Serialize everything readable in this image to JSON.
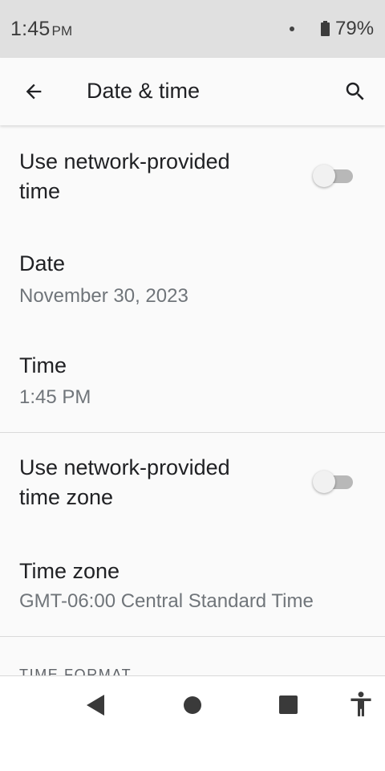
{
  "status_bar": {
    "time": "1:45",
    "ampm": "PM",
    "battery": "79%"
  },
  "app_bar": {
    "title": "Date & time",
    "back_icon": "arrow-back-icon",
    "search_icon": "search-icon"
  },
  "settings": {
    "auto_time": {
      "title_line1": "Use network-provided",
      "title_line2": "time",
      "enabled": false
    },
    "date": {
      "title": "Date",
      "value": "November 30, 2023"
    },
    "time": {
      "title": "Time",
      "value": "1:45 PM"
    },
    "auto_time_zone": {
      "title_line1": "Use network-provided",
      "title_line2": "time zone",
      "enabled": false
    },
    "time_zone": {
      "title": "Time zone",
      "value": "GMT-06:00 Central Standard Time"
    },
    "time_format_header": "TIME FORMAT"
  },
  "nav_bar": {
    "back": "nav-back-icon",
    "home": "nav-home-icon",
    "recents": "nav-recents-icon",
    "accessibility": "accessibility-icon"
  },
  "colors": {
    "status_bar_bg": "#e0e0e0",
    "background": "#fafafa",
    "primary_text": "#202124",
    "secondary_text": "#70757a",
    "switch_track_off": "#b8b8b8",
    "switch_thumb_off": "#f1f1f1"
  }
}
